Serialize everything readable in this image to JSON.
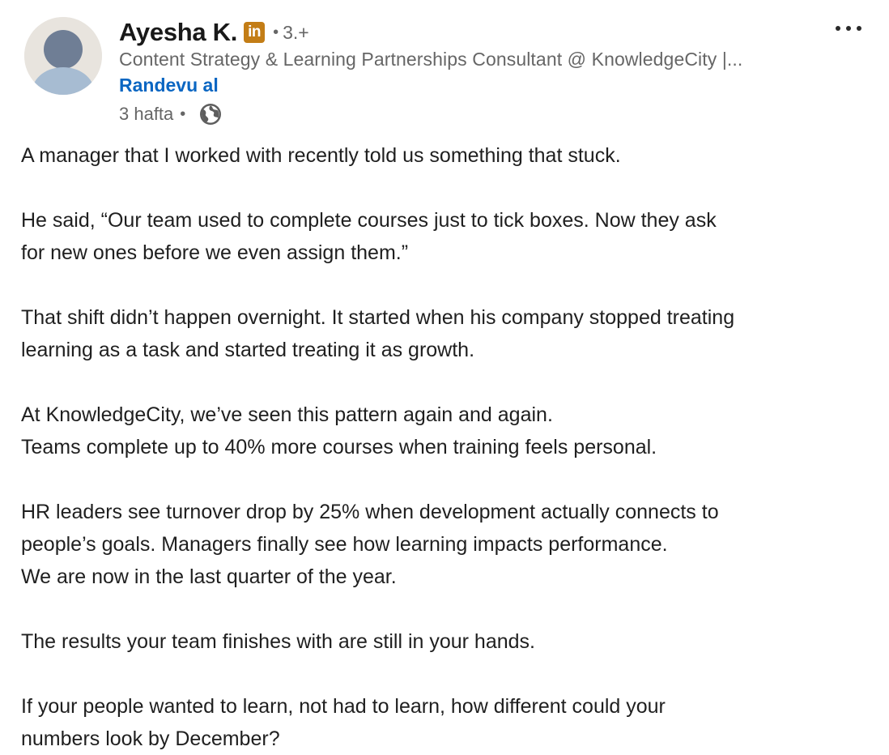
{
  "post": {
    "author": {
      "name": "Ayesha K.",
      "badge_text": "in",
      "separator": "•",
      "degree": "3.+",
      "headline": "Content Strategy & Learning Partnerships Consultant @ KnowledgeCity |...",
      "avatar_icon": "person-silhouette-icon",
      "avatar_bg": "#e8e4de"
    },
    "cta_label": "Randevu al",
    "time_ago": "3 hafta",
    "meta_separator": "•",
    "visibility_icon": "globe-icon",
    "more_icon": "more-horizontal-icon",
    "colors": {
      "link": "#0a66c2",
      "badge": "#c37d16",
      "secondary_text": "#666666"
    },
    "body_lines": [
      "A manager that I worked with recently told us something that stuck.",
      "",
      " He said, “Our team used to complete courses just to tick boxes. Now they ask",
      "for new ones before we even assign them.”",
      "",
      "That shift didn’t happen overnight. It started when his company stopped treating",
      "learning as a task and started treating it as growth.",
      "",
      "At KnowledgeCity, we’ve seen this pattern again and again.",
      " Teams complete up to 40% more courses when training feels personal.",
      "",
      " HR leaders see turnover drop by 25% when development actually connects to",
      "people’s goals. Managers finally see how learning impacts performance.",
      "We are now in the last quarter of the year.",
      "",
      "The results your team finishes with are still in your hands.",
      "",
      "If your people wanted to learn, not had to learn, how different could your",
      "numbers look by December?"
    ]
  }
}
